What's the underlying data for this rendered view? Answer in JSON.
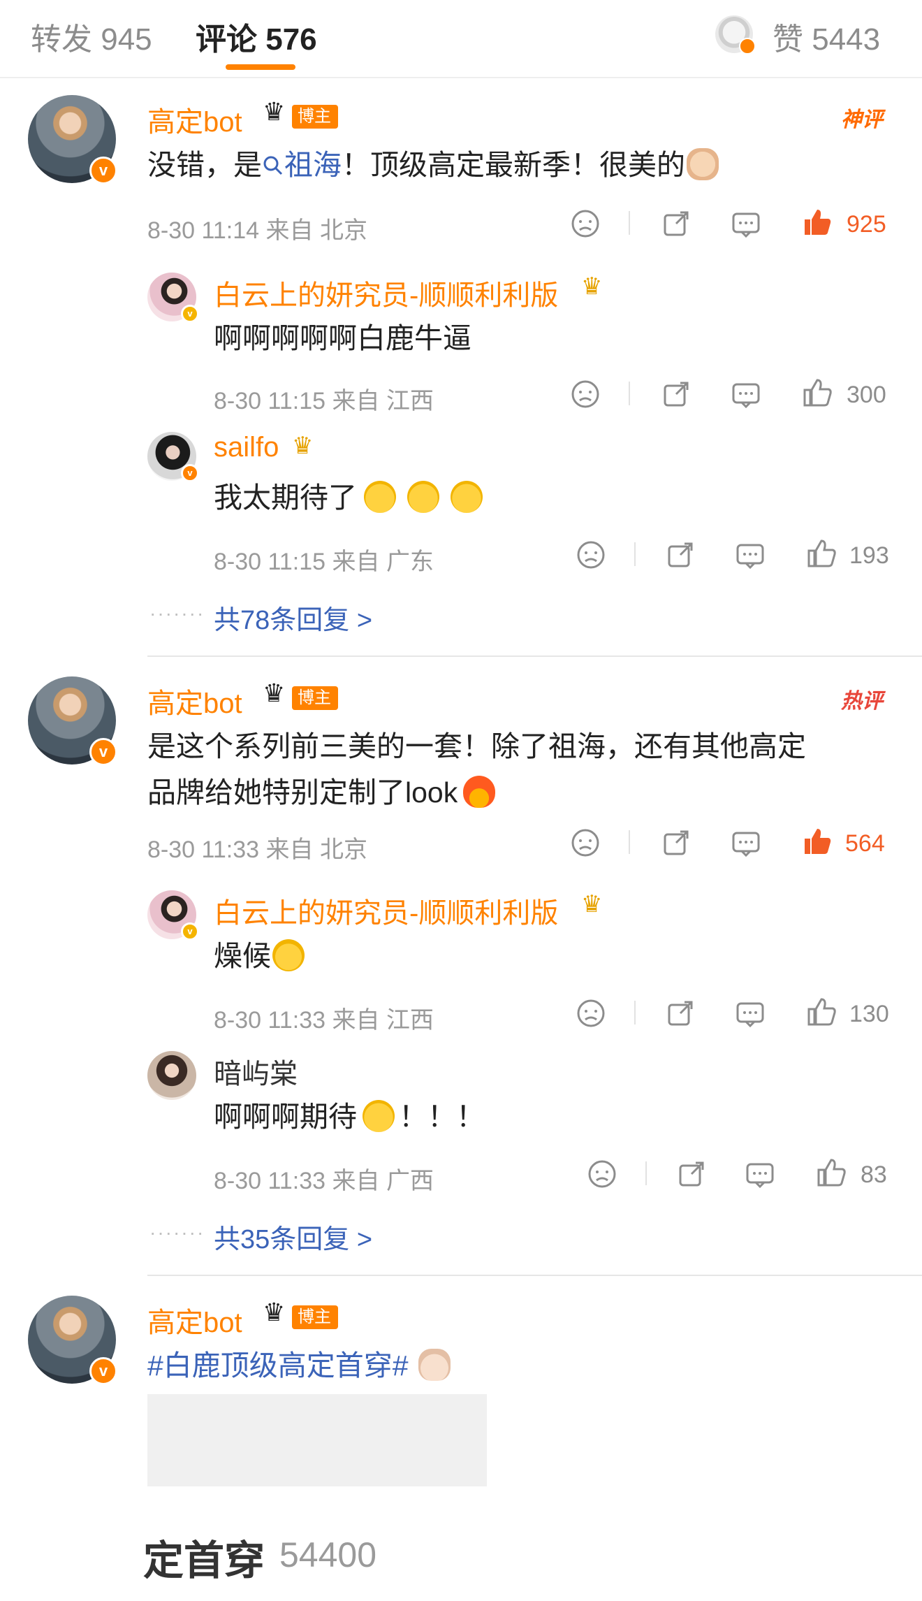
{
  "tabs": {
    "repost": "转发 945",
    "comments": "评论 576",
    "likes": "赞 5443"
  },
  "comments": [
    {
      "user": "高定bot",
      "badge": "博主",
      "tag": "神评",
      "text_parts": [
        "没错，是",
        "祖海",
        "！顶级高定最新季！很美的"
      ],
      "meta": "8-30 11:14 来自 北京",
      "likes": "925",
      "replies": [
        {
          "user": "白云上的妍究员-顺顺利利版",
          "text": "啊啊啊啊啊白鹿牛逼",
          "meta": "8-30 11:15 来自 江西",
          "likes": "300"
        },
        {
          "user": "sailfo",
          "text": "我太期待了",
          "meta": "8-30 11:15 来自 广东",
          "likes": "193"
        }
      ],
      "more": "共78条回复 >"
    },
    {
      "user": "高定bot",
      "badge": "博主",
      "tag": "热评",
      "text_line1": "是这个系列前三美的一套！除了祖海，还有其他高定",
      "text_line2": "品牌给她特别定制了look",
      "meta": "8-30 11:33 来自 北京",
      "likes": "564",
      "replies": [
        {
          "user": "白云上的妍究员-顺顺利利版",
          "text": "燥候",
          "meta": "8-30 11:33 来自 江西",
          "likes": "130"
        },
        {
          "user": "暗屿棠",
          "text": "啊啊啊期待",
          "text_suffix": "！！！",
          "meta": "8-30 11:33 来自 广西",
          "likes": "83"
        }
      ],
      "more": "共35条回复 >"
    },
    {
      "user": "高定bot",
      "badge": "博主",
      "text": "#白鹿顶级高定首穿#"
    }
  ],
  "bottom": {
    "text": "定首穿",
    "count": "54400"
  },
  "colors": {
    "accent": "#ff8200",
    "link": "#3b63b8",
    "liked": "#f25d25"
  }
}
